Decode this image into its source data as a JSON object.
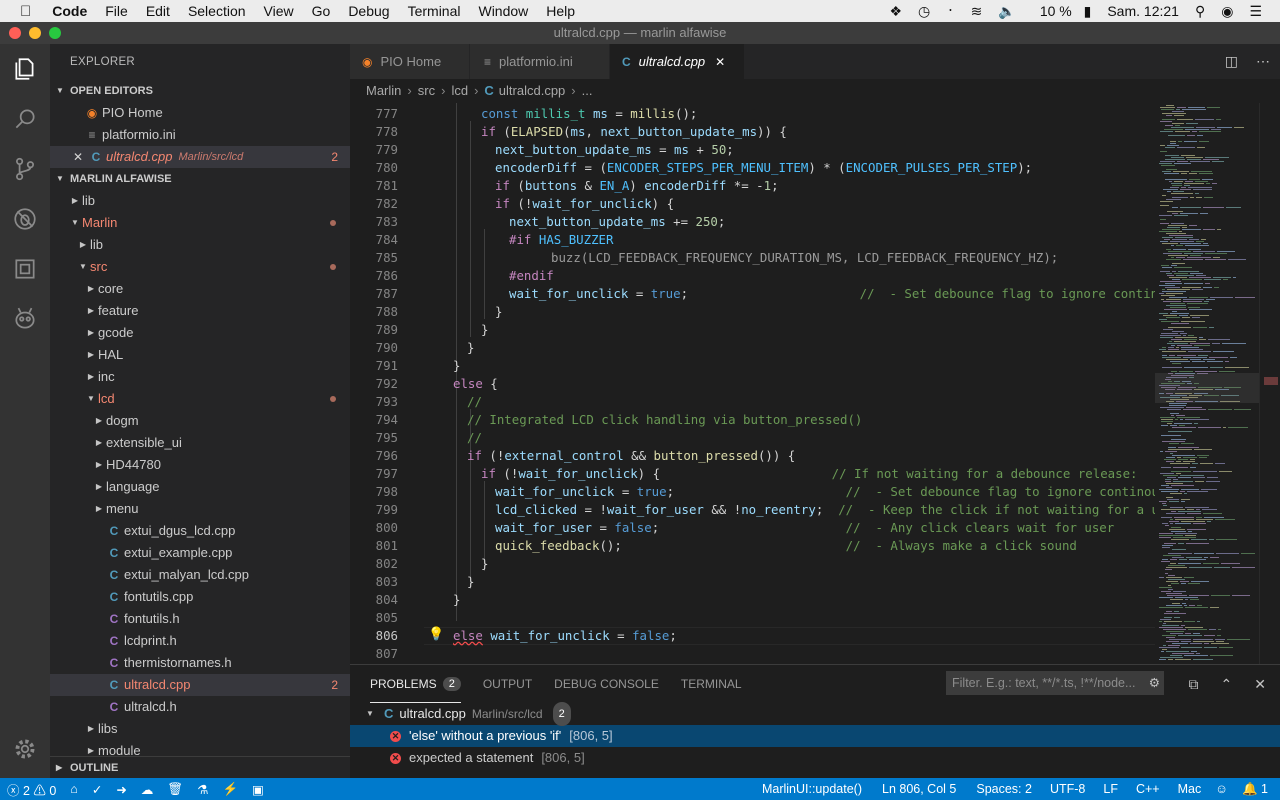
{
  "menubar": {
    "app": "Code",
    "items": [
      "File",
      "Edit",
      "Selection",
      "View",
      "Go",
      "Debug",
      "Terminal",
      "Window",
      "Help"
    ],
    "battery": "10 %",
    "clock": "Sam. 12:21"
  },
  "window_title": "ultralcd.cpp — marlin alfawise",
  "explorer": {
    "title": "EXPLORER",
    "open_editors_label": "OPEN EDITORS",
    "open_editors": [
      {
        "name": "PIO Home",
        "path": "",
        "badge": ""
      },
      {
        "name": "platformio.ini",
        "path": "",
        "badge": ""
      },
      {
        "name": "ultralcd.cpp",
        "path": "Marlin/src/lcd",
        "badge": "2"
      }
    ],
    "project_label": "MARLIN ALFAWISE",
    "tree": [
      {
        "name": "lib",
        "depth": 0
      },
      {
        "name": "Marlin",
        "depth": 0
      },
      {
        "name": "lib",
        "depth": 1
      },
      {
        "name": "src",
        "depth": 1
      },
      {
        "name": "core",
        "depth": 2
      },
      {
        "name": "feature",
        "depth": 2
      },
      {
        "name": "gcode",
        "depth": 2
      },
      {
        "name": "HAL",
        "depth": 2
      },
      {
        "name": "inc",
        "depth": 2
      },
      {
        "name": "lcd",
        "depth": 2
      },
      {
        "name": "dogm",
        "depth": 3
      },
      {
        "name": "extensible_ui",
        "depth": 3
      },
      {
        "name": "HD44780",
        "depth": 3
      },
      {
        "name": "language",
        "depth": 3
      },
      {
        "name": "menu",
        "depth": 3
      },
      {
        "name": "extui_dgus_lcd.cpp",
        "depth": 3
      },
      {
        "name": "extui_example.cpp",
        "depth": 3
      },
      {
        "name": "extui_malyan_lcd.cpp",
        "depth": 3
      },
      {
        "name": "fontutils.cpp",
        "depth": 3
      },
      {
        "name": "fontutils.h",
        "depth": 3
      },
      {
        "name": "lcdprint.h",
        "depth": 3
      },
      {
        "name": "thermistornames.h",
        "depth": 3
      },
      {
        "name": "ultralcd.cpp",
        "depth": 3,
        "badge": "2"
      },
      {
        "name": "ultralcd.h",
        "depth": 3
      },
      {
        "name": "libs",
        "depth": 2
      },
      {
        "name": "module",
        "depth": 2
      }
    ],
    "outline_label": "OUTLINE"
  },
  "tabs": [
    "PIO Home",
    "platformio.ini",
    "ultralcd.cpp"
  ],
  "breadcrumb": [
    "Marlin",
    "src",
    "lcd",
    "ultralcd.cpp",
    "..."
  ],
  "code": {
    "line_numbers": [
      "777",
      "778",
      "779",
      "780",
      "781",
      "782",
      "783",
      "784",
      "785",
      "786",
      "787",
      "788",
      "789",
      "790",
      "791",
      "792",
      "793",
      "794",
      "795",
      "796",
      "797",
      "798",
      "799",
      "800",
      "801",
      "802",
      "803",
      "804",
      "805",
      "806",
      "807"
    ],
    "current_line": "806"
  },
  "panel": {
    "tabs": [
      {
        "label": "PROBLEMS",
        "badge": "2"
      },
      {
        "label": "OUTPUT",
        "badge": ""
      },
      {
        "label": "DEBUG CONSOLE",
        "badge": ""
      },
      {
        "label": "TERMINAL",
        "badge": ""
      }
    ],
    "filter_placeholder": "Filter. E.g.: text, **/*.ts, !**/node...",
    "file": {
      "name": "ultralcd.cpp",
      "path": "Marlin/src/lcd",
      "count": "2"
    },
    "problems": [
      {
        "message": "'else' without a previous 'if'",
        "location": "[806, 5]"
      },
      {
        "message": "expected a statement",
        "location": "[806, 5]"
      }
    ]
  },
  "statusbar": {
    "errors": "2",
    "warnings": "0",
    "scope": "MarlinUI::update()",
    "position": "Ln 806, Col 5",
    "spaces": "Spaces: 2",
    "encoding": "UTF-8",
    "eol": "LF",
    "language": "C++",
    "platform": "Mac",
    "notifications": "1"
  }
}
